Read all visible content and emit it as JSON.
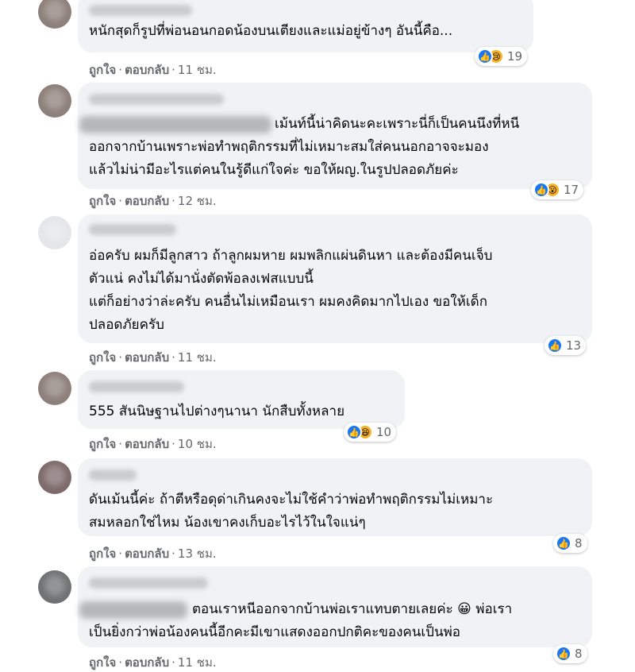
{
  "comments": [
    {
      "text": "หนักสุดก็รูปที่พ่อนอนกอดน้องบนเตียงและแม่อยู่ข้างๆ อันนี้คือ...",
      "like": "ถูกใจ",
      "reply": "ตอบกลับ",
      "time": "11 ชม.",
      "reaction_count": "19",
      "reactions": [
        "like-icon",
        "sad-icon"
      ]
    },
    {
      "text": "เม้นท์นี้น่าคิดนะคะเพราะนี่ก็เป็นคนนึงที่หนี\nออกจากบ้านเพราะพ่อทำพฤติกรรมที่ไม่เหมาะสมใส่คนนอกอาจจะมอง\nแล้วไม่น่ามีอะไรแต่คนในรู้ดีแก่ใจค่ะ ขอให้ผญ.ในรูปปลอดภัยค่ะ",
      "like": "ถูกใจ",
      "reply": "ตอบกลับ",
      "time": "12 ชม.",
      "reaction_count": "17",
      "reactions": [
        "like-icon",
        "wow-icon"
      ]
    },
    {
      "text": "อ่อครับ ผมก็มีลูกสาว ถ้าลูกผมหาย ผมพลิกแผ่นดินหา และต้องมีคนเจ็บ\nตัวแน่ คงไม่ได้มานั่งตัดพ้อลงเฟสแบบนี้\nแต่ก็อย่างว่าล่ะครับ คนอื่นไม่เหมือนเรา ผมคงคิดมากไปเอง ขอให้เด็ก\nปลอดภัยครับ",
      "like": "ถูกใจ",
      "reply": "ตอบกลับ",
      "time": "11 ชม.",
      "reaction_count": "13",
      "reactions": [
        "like-icon"
      ]
    },
    {
      "text": "555 สันนิษฐานไปต่างๆนานา นักสืบทั้งหลาย",
      "like": "ถูกใจ",
      "reply": "ตอบกลับ",
      "time": "10 ชม.",
      "reaction_count": "10",
      "reactions": [
        "like-icon",
        "laugh-icon"
      ]
    },
    {
      "text": "ดันเม้นนี้ค่ะ ถ้าตีหรือดุด่าเกินคงจะไม่ใช้คำว่าพ่อทำพฤติกรรมไม่เหมาะ\nสมหลอกใช่ไหม น้องเขาคงเก็บอะไรไว้ในใจแน่ๆ",
      "like": "ถูกใจ",
      "reply": "ตอบกลับ",
      "time": "13 ชม.",
      "reaction_count": "8",
      "reactions": [
        "like-icon"
      ]
    },
    {
      "text": "ตอนเราหนีออกจากบ้านพ่อเราแทบตายเลยค่ะ 😀 พ่อเรา\nเป็นยิ่งกว่าพ่อน้องคนนี้อีกคะมีเขาแสดงออกปกติคะของคนเป็นพ่อ",
      "like": "ถูกใจ",
      "reply": "ตอบกลับ",
      "time": "11 ชม.",
      "reaction_count": "8",
      "reactions": [
        "like-icon"
      ]
    }
  ],
  "icons": {
    "like-icon": "👍",
    "sad-icon": "😢",
    "wow-icon": "😮",
    "laugh-icon": "😆"
  },
  "colors": {
    "bubble": "#f0f2f5",
    "meta_text": "#65676b",
    "like_blue": "#1877f2",
    "emoji_yellow": "#f7b125"
  }
}
